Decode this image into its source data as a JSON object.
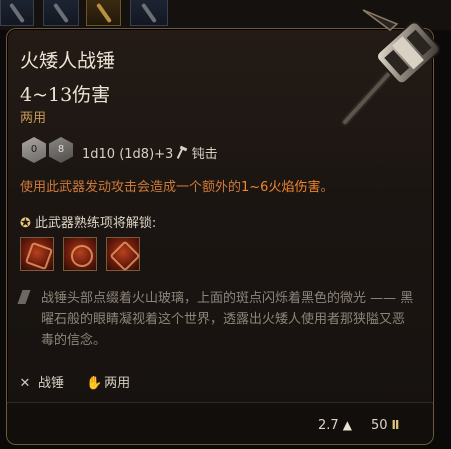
{
  "top_strip": {
    "slots": [
      "weapon-slot-a",
      "weapon-slot-b",
      "weapon-slot-c",
      "weapon-slot-d"
    ]
  },
  "item": {
    "name": "火矮人战锤",
    "damage": "4~13伤害",
    "subtype": "两用",
    "dice": [
      "0",
      "8"
    ],
    "damage_line": "1d10 (1d8)+3",
    "damage_type": "钝击",
    "effect_prefix": "使用此武器发动攻击会造成一个额外的",
    "effect_highlight": "1~6火焰伤害",
    "effect_suffix": "。",
    "unlock_title": "此武器熟练项将解锁:",
    "abilities": [
      "fire-strike-icon",
      "fire-smash-icon",
      "fire-cleave-icon"
    ],
    "flavor": "战锤头部点缀着火山玻璃，上面的斑点闪烁着黑色的微光 —— 黑曜石般的眼睛凝视着这个世界，透露出火矮人使用者那狭隘又恶毒的信念。",
    "prop_weapon": "战锤",
    "prop_hands": "两用",
    "weight": "2.7",
    "price": "50"
  },
  "colors": {
    "accent_orange": "#f0862e",
    "effect_text": "#cf7a3a",
    "subtype_text": "#c99b57",
    "border": "#6d5a3d"
  }
}
